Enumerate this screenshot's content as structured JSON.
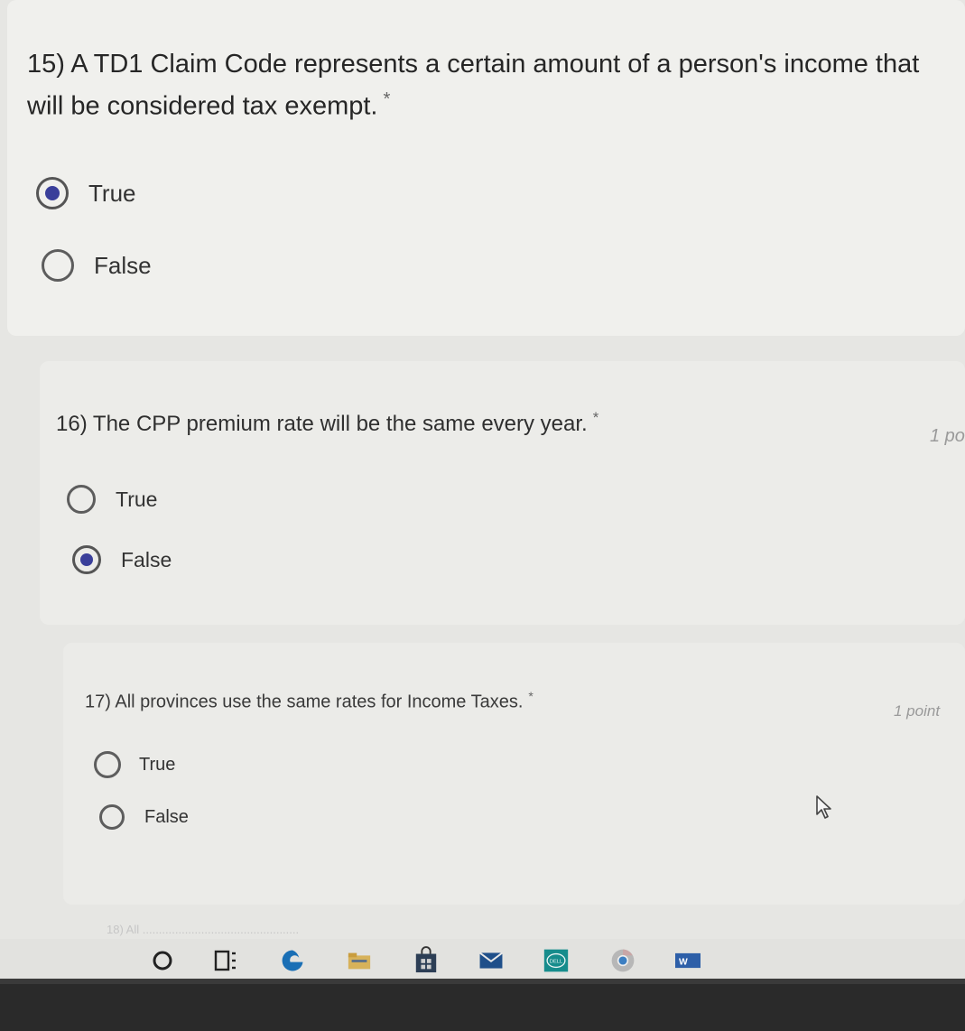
{
  "questions": [
    {
      "number_text": "15) A TD1 Claim Code represents a certain amount of a person's income that will be considered tax exempt.",
      "required_marker": "*",
      "points": "",
      "options": [
        {
          "label": "True",
          "checked": true
        },
        {
          "label": "False",
          "checked": false
        }
      ]
    },
    {
      "number_text": "16) The CPP premium rate will be the same every year.",
      "required_marker": "*",
      "points": "1 po",
      "options": [
        {
          "label": "True",
          "checked": false
        },
        {
          "label": "False",
          "checked": true
        }
      ]
    },
    {
      "number_text": "17) All provinces use the same rates for Income Taxes.",
      "required_marker": "*",
      "points": "1 point",
      "options": [
        {
          "label": "True",
          "checked": false
        },
        {
          "label": "False",
          "checked": false
        }
      ]
    }
  ],
  "next_question_hint": "18) All ................................................",
  "colors": {
    "accent": "#3a3f9a",
    "page_background": "#e6e6e3",
    "card_background": "#efefec"
  },
  "taskbar_icons": [
    "cortana-search-icon",
    "task-view-icon",
    "edge-icon",
    "file-explorer-icon",
    "store-icon",
    "mail-icon",
    "dell-icon",
    "chrome-icon",
    "word-icon"
  ],
  "taskbar_word_letter": "W",
  "taskbar_dell_letters": "DELL"
}
